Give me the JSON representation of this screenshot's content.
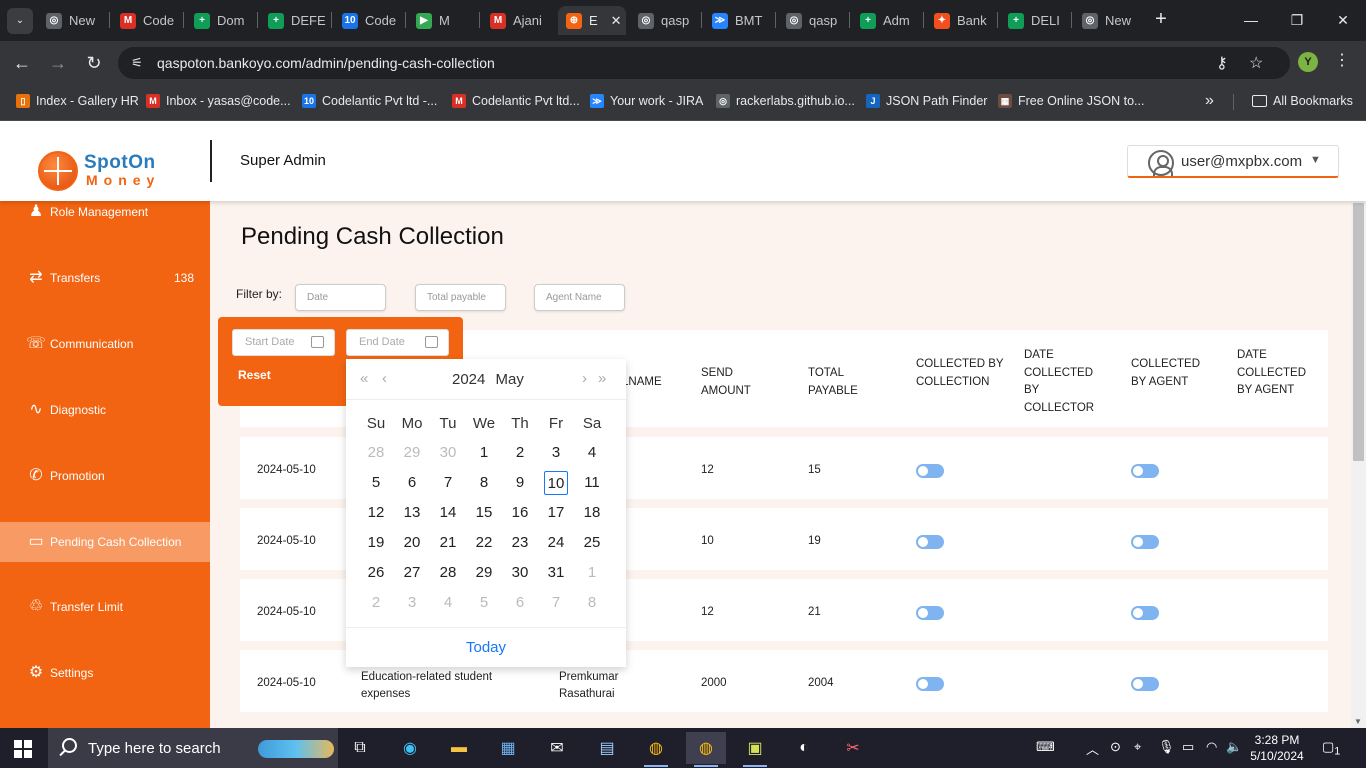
{
  "browser": {
    "tabs": [
      {
        "label": "New",
        "fav_color": "#5f6368",
        "fav_glyph": "◎"
      },
      {
        "label": "Code",
        "fav_color": "#d93025",
        "fav_glyph": "M"
      },
      {
        "label": "Dom",
        "fav_color": "#0f9d58",
        "fav_glyph": "+"
      },
      {
        "label": "DEFE",
        "fav_color": "#0f9d58",
        "fav_glyph": "+"
      },
      {
        "label": "Code",
        "fav_color": "#1a73e8",
        "fav_glyph": "10"
      },
      {
        "label": "M",
        "fav_color": "#34a853",
        "fav_glyph": "▶"
      },
      {
        "label": "Ajani",
        "fav_color": "#d93025",
        "fav_glyph": "M"
      },
      {
        "label": "E",
        "fav_color": "#f26411",
        "fav_glyph": "⊕"
      },
      {
        "label": "qasp",
        "fav_color": "#5f6368",
        "fav_glyph": "◎"
      },
      {
        "label": "BMT",
        "fav_color": "#2684ff",
        "fav_glyph": "≫"
      },
      {
        "label": "qasp",
        "fav_color": "#5f6368",
        "fav_glyph": "◎"
      },
      {
        "label": "Adm",
        "fav_color": "#0f9d58",
        "fav_glyph": "+"
      },
      {
        "label": "Bank",
        "fav_color": "#f24e1e",
        "fav_glyph": "✦"
      },
      {
        "label": "DELI",
        "fav_color": "#0f9d58",
        "fav_glyph": "+"
      },
      {
        "label": "New",
        "fav_color": "#5f6368",
        "fav_glyph": "◎"
      }
    ],
    "active_tab_close": "✕",
    "new_tab": "+",
    "url": "qaspoton.bankoyo.com/admin/pending-cash-collection",
    "profile_initial": "Y",
    "bookmarks": [
      {
        "label": "Index - Gallery HR",
        "fav_color": "#e8710a",
        "fav_glyph": "▯"
      },
      {
        "label": "Inbox - yasas@code...",
        "fav_color": "#d93025",
        "fav_glyph": "M"
      },
      {
        "label": "Codelantic Pvt ltd -...",
        "fav_color": "#1a73e8",
        "fav_glyph": "10"
      },
      {
        "label": "Codelantic Pvt ltd...",
        "fav_color": "#d93025",
        "fav_glyph": "M"
      },
      {
        "label": "Your work - JIRA",
        "fav_color": "#2684ff",
        "fav_glyph": "≫"
      },
      {
        "label": "rackerlabs.github.io...",
        "fav_color": "#5f6368",
        "fav_glyph": "◎"
      },
      {
        "label": "JSON Path Finder",
        "fav_color": "#1565c0",
        "fav_glyph": "J"
      },
      {
        "label": "Free Online JSON to...",
        "fav_color": "#6d4c41",
        "fav_glyph": "▦"
      }
    ],
    "bookmarks_more": "»",
    "all_bookmarks": "All Bookmarks"
  },
  "header": {
    "logo_line1": "SpotOn",
    "logo_line2": "Money",
    "role": "Super Admin",
    "user_email": "user@mxpbx.com"
  },
  "sidebar": {
    "items": [
      {
        "label": "Role Management",
        "icon": "users-icon",
        "glyph": "♟",
        "count": ""
      },
      {
        "label": "Transfers",
        "icon": "money-transfer-icon",
        "glyph": "⇄",
        "count": "138"
      },
      {
        "label": "Communication",
        "icon": "chat-icon",
        "glyph": "☏",
        "count": ""
      },
      {
        "label": "Diagnostic",
        "icon": "pulse-icon",
        "glyph": "∿",
        "count": ""
      },
      {
        "label": "Promotion",
        "icon": "megaphone-icon",
        "glyph": "✆",
        "count": ""
      },
      {
        "label": "Pending Cash Collection",
        "icon": "card-icon",
        "glyph": "▭",
        "count": ""
      },
      {
        "label": "Transfer Limit",
        "icon": "recycle-icon",
        "glyph": "♲",
        "count": ""
      },
      {
        "label": "Settings",
        "icon": "gear-icon",
        "glyph": "⚙",
        "count": ""
      }
    ],
    "active_index": 5
  },
  "main": {
    "title": "Pending Cash Collection",
    "filter_label": "Filter by:",
    "filters": {
      "date_placeholder": "Date",
      "total_payable_placeholder": "Total payable",
      "agent_name_placeholder": "Agent Name"
    },
    "range": {
      "start_placeholder": "Start Date",
      "end_placeholder": "End Date",
      "reset_label": "Reset"
    },
    "columns": [
      "LNAME",
      "SEND AMOUNT",
      "TOTAL PAYABLE",
      "COLLECTED BY COLLECTION",
      "DATE COLLECTED BY COLLECTOR",
      "COLLECTED BY AGENT",
      "DATE COLLECTED BY AGENT"
    ],
    "rows": [
      {
        "date": "2024-05-10",
        "description": "",
        "name": "",
        "send_amount": "12",
        "total_payable": "15"
      },
      {
        "date": "2024-05-10",
        "description": "",
        "name": "",
        "send_amount": "10",
        "total_payable": "19"
      },
      {
        "date": "2024-05-10",
        "description": "",
        "name": "",
        "send_amount": "12",
        "total_payable": "21"
      },
      {
        "date": "2024-05-10",
        "description": "Education-related student expenses",
        "name": "Premkumar Rasathurai",
        "send_amount": "2000",
        "total_payable": "2004"
      }
    ]
  },
  "calendar": {
    "year": "2024",
    "month": "May",
    "weekdays": [
      "Su",
      "Mo",
      "Tu",
      "We",
      "Th",
      "Fr",
      "Sa"
    ],
    "weeks": [
      [
        "28",
        "29",
        "30",
        "1",
        "2",
        "3",
        "4"
      ],
      [
        "5",
        "6",
        "7",
        "8",
        "9",
        "10",
        "11"
      ],
      [
        "12",
        "13",
        "14",
        "15",
        "16",
        "17",
        "18"
      ],
      [
        "19",
        "20",
        "21",
        "22",
        "23",
        "24",
        "25"
      ],
      [
        "26",
        "27",
        "28",
        "29",
        "30",
        "31",
        "1"
      ],
      [
        "2",
        "3",
        "4",
        "5",
        "6",
        "7",
        "8"
      ]
    ],
    "today_day": "10",
    "today_label": "Today"
  },
  "taskbar": {
    "search_placeholder": "Type here to search",
    "time": "3:28 PM",
    "date": "5/10/2024",
    "notification_count": "1"
  }
}
